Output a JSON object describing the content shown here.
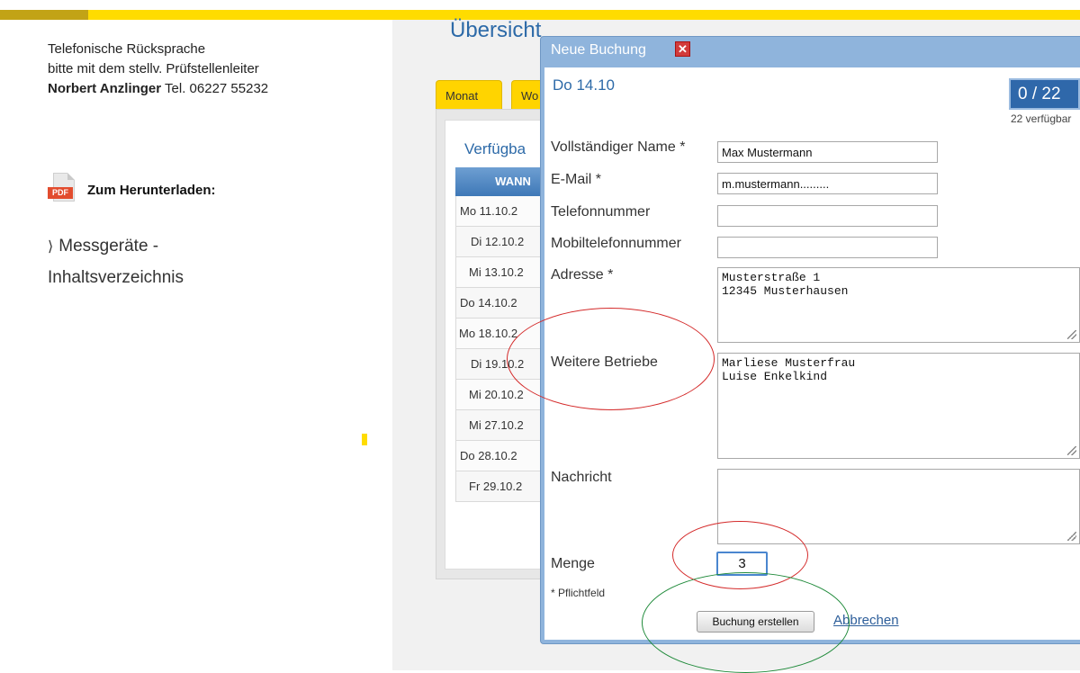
{
  "sidebar": {
    "contact_line1": "Telefonische Rücksprache",
    "contact_line2": "bitte mit dem stellv. Prüfstellenleiter",
    "contact_name": "Norbert Anzlinger",
    "contact_phone": "Tel. 06227 55232",
    "pdf_tag": "PDF",
    "downloads_title": "Zum Herunterladen:",
    "download_link_line1": "Messgeräte -",
    "download_link_line2": "Inhaltsverzeichnis"
  },
  "main": {
    "title": "Übersicht",
    "tabs": [
      {
        "label": "Monat"
      },
      {
        "label": "Wo"
      }
    ],
    "availability_title": "Verfügba",
    "table_header": "WANN",
    "dates": [
      "Mo 11.10.2",
      "Di 12.10.2",
      "Mi 13.10.2",
      "Do 14.10.2",
      "Mo 18.10.2",
      "Di 19.10.2",
      "Mi 20.10.2",
      "Mi 27.10.2",
      "Do 28.10.2",
      "Fr 29.10.2"
    ]
  },
  "dialog": {
    "title": "Neue Buchung",
    "close_glyph": "✕",
    "date": "Do 14.10",
    "counter": "0 / 22",
    "counter_sub": "22 verfügbar",
    "fields": {
      "name_label": "Vollständiger Name *",
      "name_value": "Max Mustermann",
      "email_label": "E-Mail *",
      "email_value": "m.mustermann.........",
      "phone_label": "Telefonnummer",
      "phone_value": "",
      "mobile_label": "Mobiltelefonnummer",
      "mobile_value": "",
      "address_label": "Adresse *",
      "address_value": "Musterstraße 1\n12345 Musterhausen",
      "more_label": "Weitere Betriebe",
      "more_value": "Marliese Musterfrau\nLuise Enkelkind",
      "message_label": "Nachricht",
      "message_value": "",
      "quantity_label": "Menge",
      "quantity_value": "3"
    },
    "required_note": "* Pflichtfeld",
    "submit_label": "Buchung erstellen",
    "cancel_label": "Abbrechen"
  },
  "colors": {
    "accent_yellow": "#ffdc00",
    "link_blue": "#2d6aa8",
    "dialog_frame": "#8fb4dc",
    "annotation_red": "#d42a2a",
    "annotation_green": "#1f8a3a"
  }
}
